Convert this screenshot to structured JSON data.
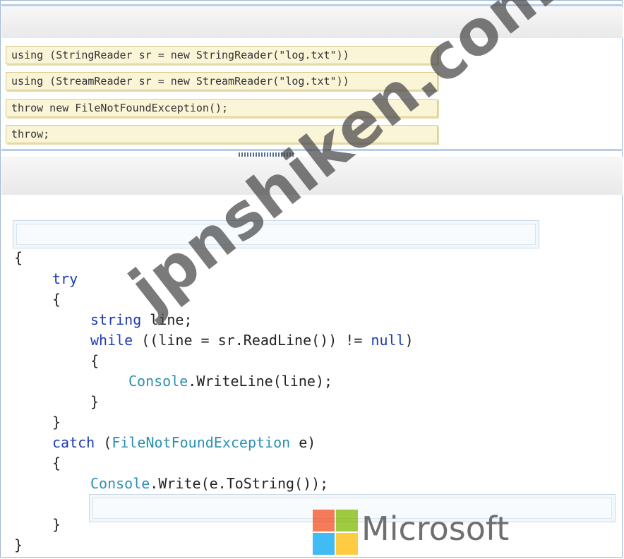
{
  "answer_tiles": [
    {
      "code": "using (StringReader sr = new StringReader(\"log.txt\"))"
    },
    {
      "code": "using (StreamReader sr = new StreamReader(\"log.txt\"))"
    },
    {
      "code": "throw new FileNotFoundException();"
    },
    {
      "code": "throw;"
    }
  ],
  "code_lines": [
    {
      "text": "{",
      "indent": 0
    },
    {
      "text": "try",
      "indent": 1
    },
    {
      "text": "{",
      "indent": 1
    },
    {
      "text": "string line;",
      "indent": 2
    },
    {
      "text": "while ((line = sr.ReadLine()) != null)",
      "indent": 2
    },
    {
      "text": "{",
      "indent": 2
    },
    {
      "text": "Console.WriteLine(line);",
      "indent": 3
    },
    {
      "text": "}",
      "indent": 2
    },
    {
      "text": "}",
      "indent": 1
    },
    {
      "text": "catch (FileNotFoundException e)",
      "indent": 1
    },
    {
      "text": "{",
      "indent": 1
    },
    {
      "text": "Console.Write(e.ToString());",
      "indent": 2
    },
    {
      "text": "}",
      "indent": 1
    },
    {
      "text": "}",
      "indent": 0
    }
  ],
  "watermark": "jpnshiken.com",
  "brand": {
    "name": "Microsoft",
    "logo_colors": [
      "#f25022",
      "#7fba00",
      "#00a4ef",
      "#ffb900"
    ]
  },
  "colors": {
    "keyword": "#1c3bb4",
    "type": "#2b91af",
    "tile_bg": "#fbf5d7"
  }
}
